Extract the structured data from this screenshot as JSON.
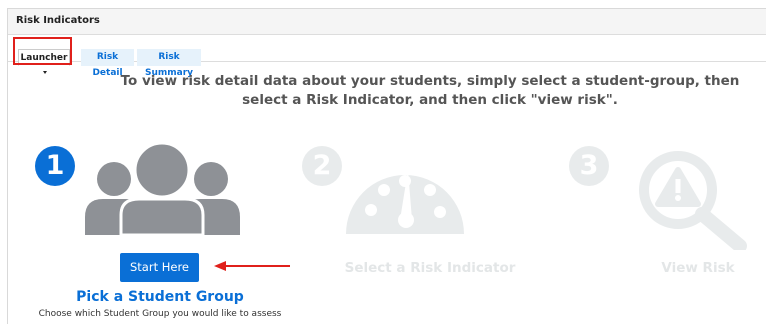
{
  "panel": {
    "title": "Risk Indicators"
  },
  "tabs": [
    {
      "label": "Launcher",
      "active": true,
      "has_dropdown": true
    },
    {
      "label": "Risk Detail",
      "active": false
    },
    {
      "label": "Risk Summary",
      "active": false
    }
  ],
  "instructions": "To view risk detail data about your students, simply select a student-group, then select a Risk Indicator, and then click \"view risk\".",
  "steps": [
    {
      "number": "1",
      "icon": "user-group-icon",
      "state": "active"
    },
    {
      "number": "2",
      "icon": "gauge-icon",
      "label": "Select a Risk Indicator",
      "state": "disabled"
    },
    {
      "number": "3",
      "icon": "warning-magnifier-icon",
      "label": "View Risk",
      "state": "disabled"
    }
  ],
  "start_button": {
    "label": "Start Here"
  },
  "step1": {
    "title": "Pick a Student Group",
    "description": "Choose which Student Group you would like to assess"
  },
  "colors": {
    "primary": "#0a6fd6",
    "disabled": "#e8ebec",
    "annotation": "#e0201b",
    "icon_gray": "#8e9196"
  }
}
